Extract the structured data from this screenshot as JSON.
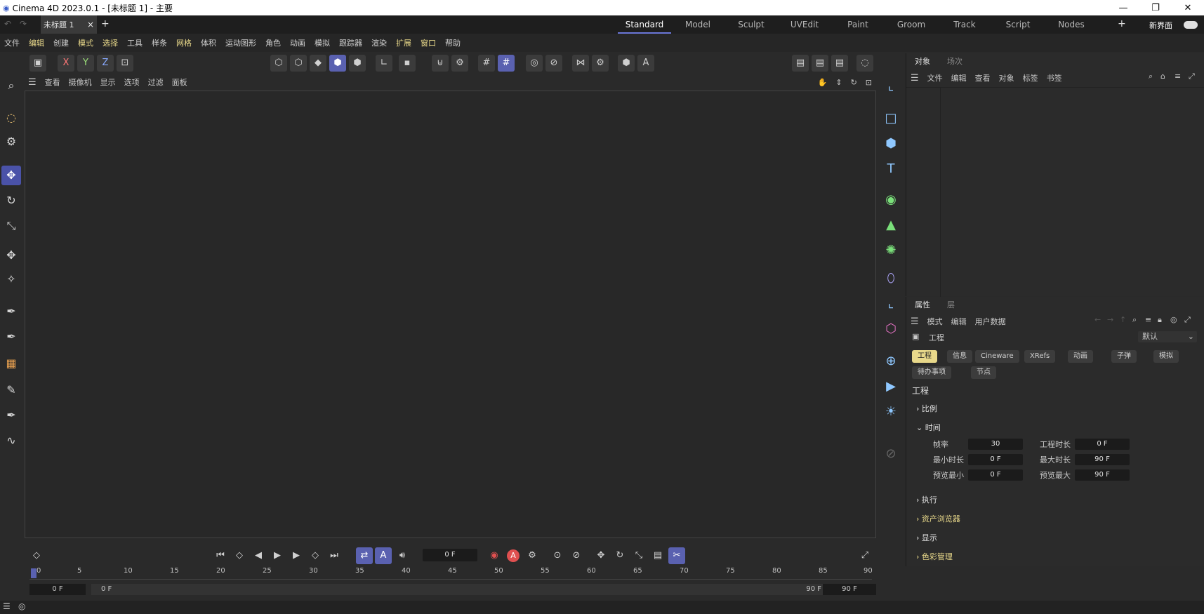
{
  "titlebar": {
    "title": "Cinema 4D 2023.0.1 - [未标题 1] - 主要",
    "minimize": "—",
    "maximize": "❐",
    "close": "✕"
  },
  "doc_tab": {
    "label": "未标题 1",
    "close": "×",
    "new": "+"
  },
  "layouts": [
    "Standard",
    "Model",
    "Sculpt",
    "UVEdit",
    "Paint",
    "Groom",
    "Track",
    "Script",
    "Nodes"
  ],
  "layout_plus": "+",
  "new_ui_label": "新界面",
  "menu": [
    "文件",
    "编辑",
    "创建",
    "模式",
    "选择",
    "工具",
    "样条",
    "网格",
    "体积",
    "运动图形",
    "角色",
    "动画",
    "模拟",
    "跟踪器",
    "渲染",
    "扩展",
    "窗口",
    "帮助"
  ],
  "axis": {
    "x": "X",
    "y": "Y",
    "z": "Z"
  },
  "viewport_menu": [
    "查看",
    "摄像机",
    "显示",
    "选项",
    "过滤",
    "面板"
  ],
  "object_panel": {
    "tabs": [
      "对象",
      "场次"
    ],
    "menu": [
      "文件",
      "编辑",
      "查看",
      "对象",
      "标签",
      "书签"
    ]
  },
  "attr_panel": {
    "tabs": [
      "属性",
      "层"
    ],
    "menu": [
      "模式",
      "编辑",
      "用户数据"
    ],
    "section_label": "工程",
    "preset": "默认",
    "chips": [
      "工程",
      "信息",
      "Cineware",
      "XRefs",
      "动画",
      "子弹",
      "模拟",
      "待办事项",
      "节点"
    ],
    "heading": "工程",
    "groups": {
      "scale": "比例",
      "time": "时间",
      "exec": "执行",
      "asset": "资产浏览器",
      "display": "显示",
      "color": "色彩管理"
    },
    "fields": {
      "fps_label": "帧率",
      "fps": "30",
      "proj_len_label": "工程时长",
      "proj_len": "0 F",
      "min_label": "最小时长",
      "min": "0 F",
      "max_label": "最大时长",
      "max": "90 F",
      "pmin_label": "预览最小",
      "pmin": "0 F",
      "pmax_label": "预览最大",
      "pmax": "90 F"
    }
  },
  "timeline": {
    "frame": "0 F",
    "ticks": [
      "0",
      "5",
      "10",
      "15",
      "20",
      "25",
      "30",
      "35",
      "40",
      "45",
      "50",
      "55",
      "60",
      "65",
      "70",
      "75",
      "80",
      "85",
      "90"
    ],
    "range_start": "0 F",
    "range_start2": "0 F",
    "range_end": "90 F",
    "range_end2": "90 F"
  },
  "colors": {
    "accent": "#5a61b0",
    "highlight": "#e8d88a",
    "icon_blue": "#8fc8ff"
  }
}
